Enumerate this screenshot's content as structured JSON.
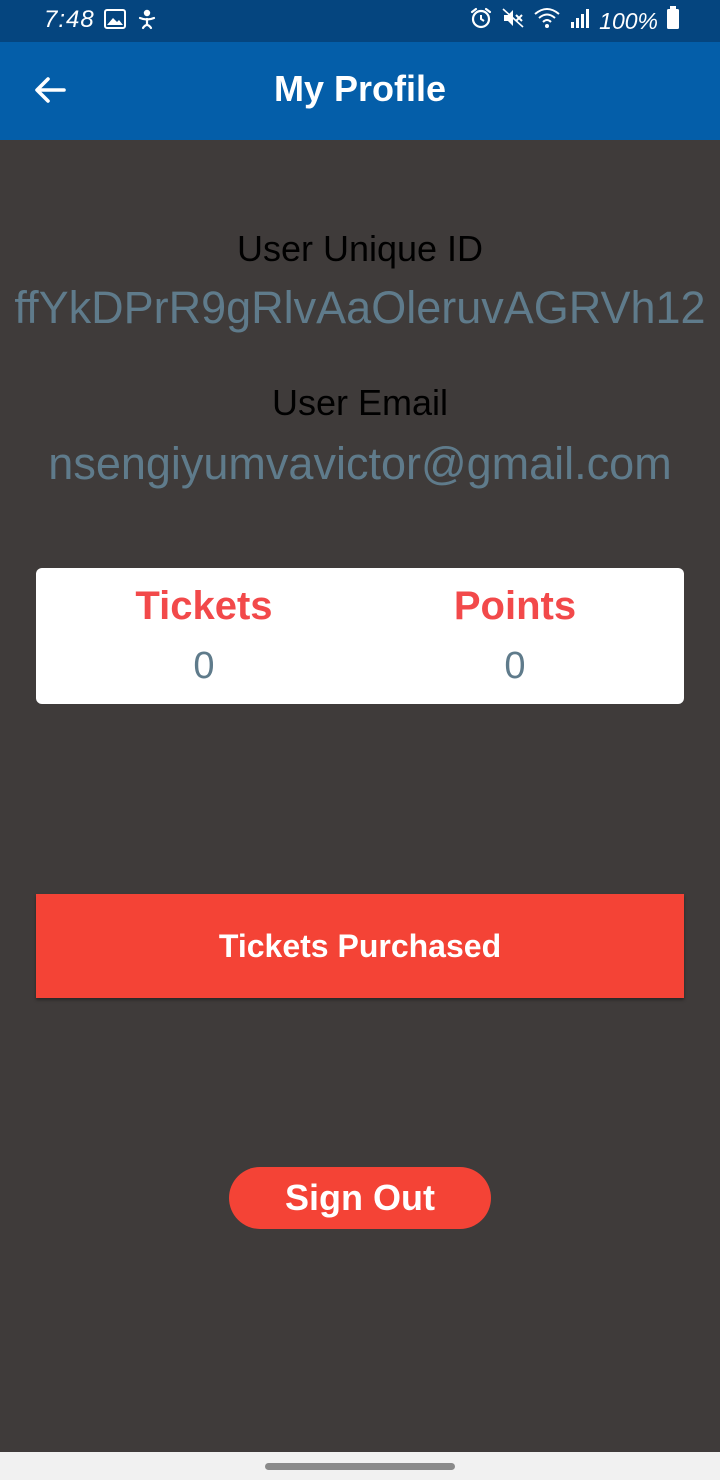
{
  "status_bar": {
    "time": "7:48",
    "battery": "100%",
    "left_icons": [
      "image-icon",
      "accessibility-icon"
    ],
    "right_icons": [
      "alarm-icon",
      "mute-icon",
      "wifi-icon",
      "signal-icon",
      "battery-icon"
    ]
  },
  "app_bar": {
    "title": "My Profile",
    "back_icon": "arrow-left-icon"
  },
  "profile": {
    "uid_label": "User Unique ID",
    "uid_value": "ffYkDPrR9gRlvAaOleruvAGRVh12",
    "email_label": "User Email",
    "email_value": "nsengiyumvavictor@gmail.com"
  },
  "stats": {
    "tickets_label": "Tickets",
    "tickets_value": "0",
    "points_label": "Points",
    "points_value": "0"
  },
  "actions": {
    "tickets_purchased_label": "Tickets Purchased",
    "sign_out_label": "Sign Out"
  },
  "colors": {
    "status_bar": "#05457f",
    "app_bar": "#045ea9",
    "background": "#3f3b3a",
    "accent_red": "#f44336",
    "stat_label_red": "#f2494a",
    "value_gray_blue": "#5f7b8b"
  }
}
